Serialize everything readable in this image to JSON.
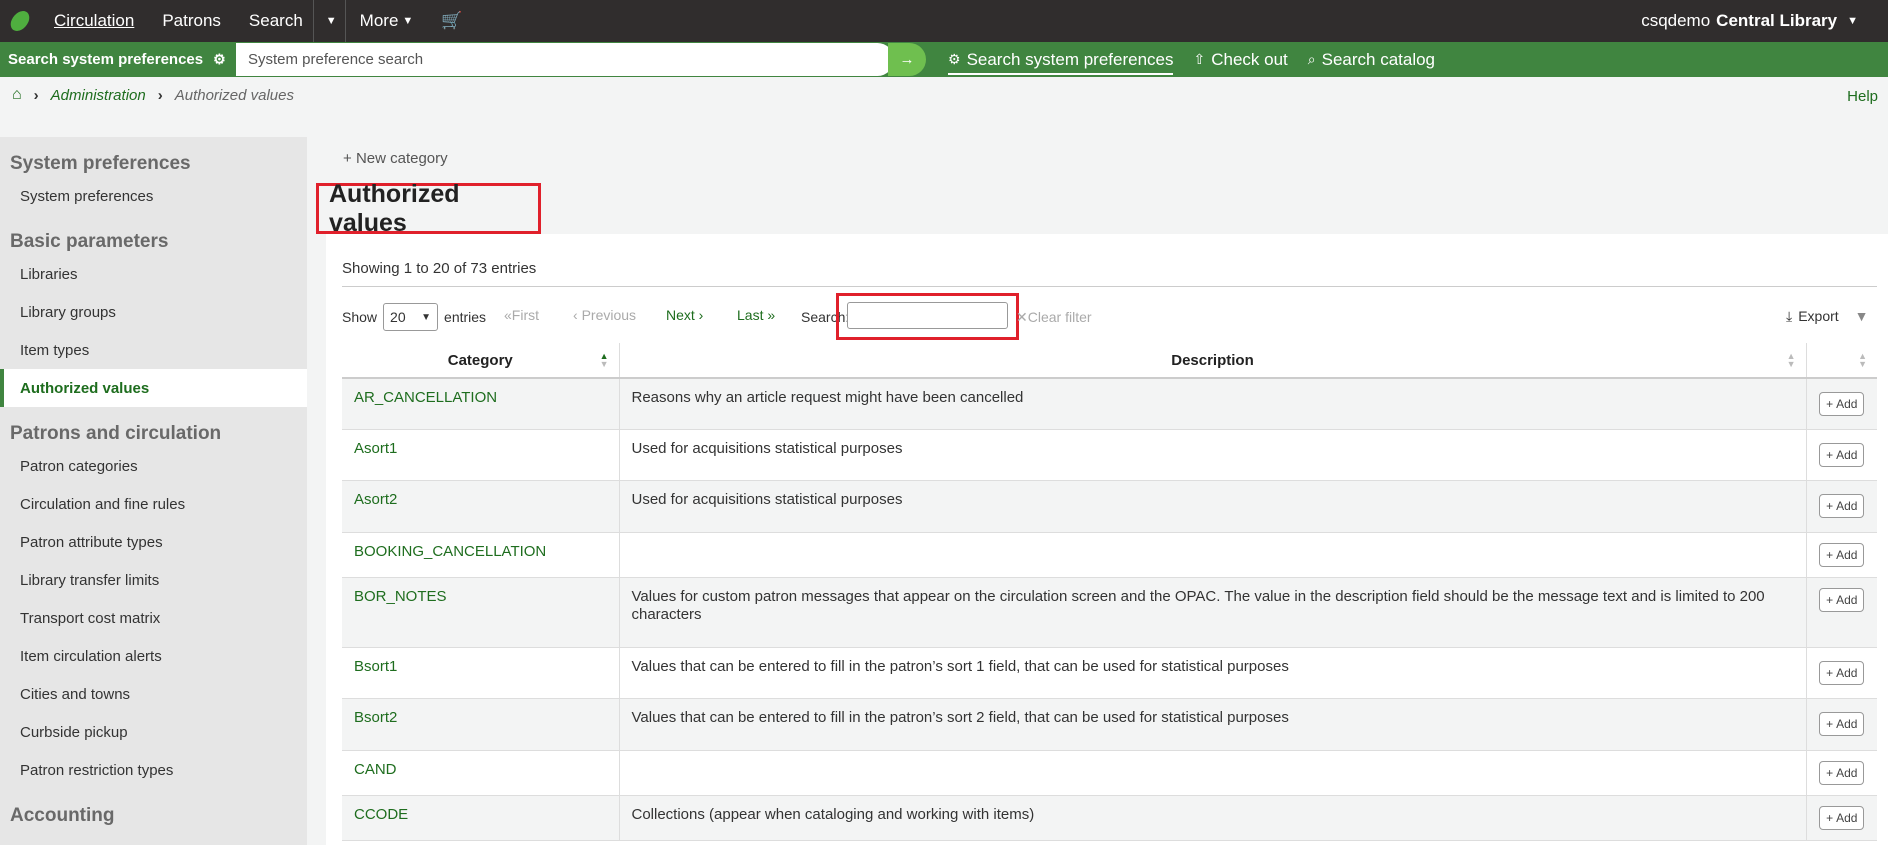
{
  "topnav": {
    "items": [
      "Circulation",
      "Patrons",
      "Search",
      "More"
    ],
    "user": "csqdemo",
    "library": "Central Library"
  },
  "searchbar": {
    "label": "Search system preferences",
    "placeholder": "System preference search",
    "options": [
      "Search system preferences",
      "Check out",
      "Search catalog"
    ]
  },
  "breadcrumb": {
    "parent": "Administration",
    "current": "Authorized values"
  },
  "help_label": "Help",
  "sidebar": {
    "sections": [
      {
        "heading": "System preferences",
        "items": [
          "System preferences"
        ]
      },
      {
        "heading": "Basic parameters",
        "items": [
          "Libraries",
          "Library groups",
          "Item types",
          "Authorized values"
        ]
      },
      {
        "heading": "Patrons and circulation",
        "items": [
          "Patron categories",
          "Circulation and fine rules",
          "Patron attribute types",
          "Library transfer limits",
          "Transport cost matrix",
          "Item circulation alerts",
          "Cities and towns",
          "Curbside pickup",
          "Patron restriction types"
        ]
      },
      {
        "heading": "Accounting",
        "items": []
      }
    ],
    "active": "Authorized values"
  },
  "main": {
    "new_category": "New category",
    "title": "Authorized values",
    "showing": "Showing 1 to 20 of 73 entries",
    "show_label": "Show",
    "page_size": "20",
    "entries_label": "entries",
    "pager": {
      "first": "First",
      "previous": "Previous",
      "next": "Next",
      "last": "Last"
    },
    "search_label": "Search:",
    "search_value": "",
    "clear_filter": "Clear filter",
    "export": "Export"
  },
  "table": {
    "columns": [
      "Category",
      "Description",
      ""
    ],
    "add_label": "Add",
    "rows": [
      {
        "category": "AR_CANCELLATION",
        "description": "Reasons why an article request might have been cancelled"
      },
      {
        "category": "Asort1",
        "description": "Used for acquisitions statistical purposes"
      },
      {
        "category": "Asort2",
        "description": "Used for acquisitions statistical purposes"
      },
      {
        "category": "BOOKING_CANCELLATION",
        "description": ""
      },
      {
        "category": "BOR_NOTES",
        "description": "Values for custom patron messages that appear on the circulation screen and the OPAC. The value in the description field should be the message text and is limited to 200 characters"
      },
      {
        "category": "Bsort1",
        "description": "Values that can be entered to fill in the patron’s sort 1 field, that can be used for statistical purposes"
      },
      {
        "category": "Bsort2",
        "description": "Values that can be entered to fill in the patron’s sort 2 field, that can be used for statistical purposes"
      },
      {
        "category": "CAND",
        "description": ""
      },
      {
        "category": "CCODE",
        "description": "Collections (appear when cataloging and working with items)"
      }
    ]
  },
  "colors": {
    "topnav_bg": "#302d2d",
    "searchbar_bg": "#408540",
    "link_green": "#1e6d1e",
    "highlight_red": "#e0202b"
  }
}
